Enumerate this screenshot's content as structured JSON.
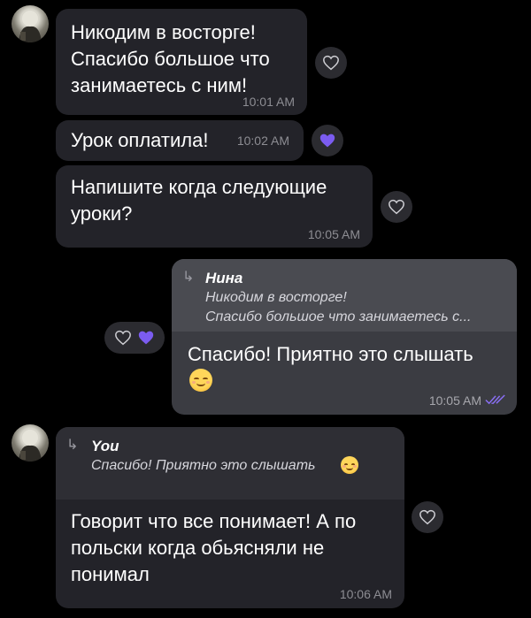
{
  "contact": {
    "name": "Нина"
  },
  "messages": [
    {
      "text": "Никодим в восторге!\nСпасибо большое что\nзанимаетесь с ним!",
      "time": "10:01 AM"
    },
    {
      "text": "Урок оплатила!",
      "time": "10:02 AM",
      "reaction": "heart-filled"
    },
    {
      "text": "Напишите когда следующие\nуроки?",
      "time": "10:05 AM"
    },
    {
      "reply_to": {
        "author": "Нина",
        "lines": [
          "Никодим в восторге!",
          "Спасибо большое что занимаетесь с..."
        ]
      },
      "text": "Спасибо! Приятно это слышать",
      "time": "10:05 AM",
      "status": "read",
      "emoji": "smiling-face-icon"
    },
    {
      "reply_to": {
        "author": "You",
        "lines": [
          "Спасибо! Приятно это слышать"
        ]
      },
      "text": "Говорит что все понимает! А по\nпольски когда обьясняли не\nпонимал",
      "time": "10:06 AM"
    }
  ],
  "colors": {
    "background": "#000000",
    "incoming_bubble": "#232329",
    "outgoing_bubble": "#3b3c42",
    "accent": "#7b5cf0"
  }
}
